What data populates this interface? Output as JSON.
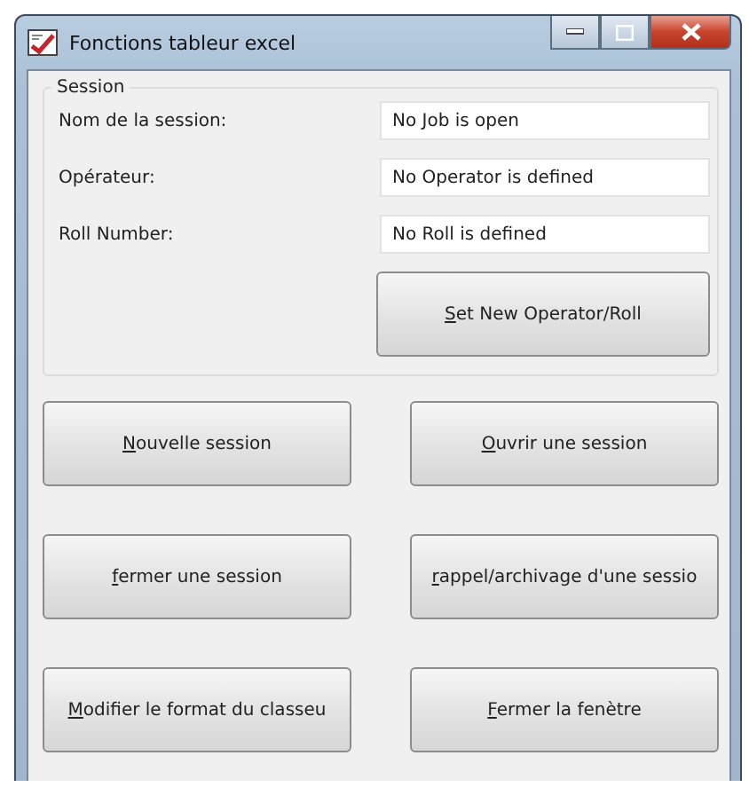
{
  "window": {
    "title": "Fonctions tableur excel"
  },
  "session": {
    "legend": "Session",
    "fields": [
      {
        "label": "Nom de la session:",
        "value": "No Job is open"
      },
      {
        "label": "Opérateur:",
        "value": "No Operator is defined"
      },
      {
        "label": "Roll Number:",
        "value": "No Roll is defined"
      }
    ],
    "button": {
      "label": "Set New Operator/Roll",
      "mnemonic": true
    }
  },
  "buttons": [
    {
      "label": "Nouvelle session",
      "mnemonic": true
    },
    {
      "label": "Ouvrir une session",
      "mnemonic": true
    },
    {
      "label": "fermer une session",
      "mnemonic": true
    },
    {
      "label": "rappel/archivage d'une sessio",
      "mnemonic": true
    },
    {
      "label": "Modifier le format du classeu",
      "mnemonic": true
    },
    {
      "label": "Fermer la fenètre",
      "mnemonic": true
    }
  ]
}
